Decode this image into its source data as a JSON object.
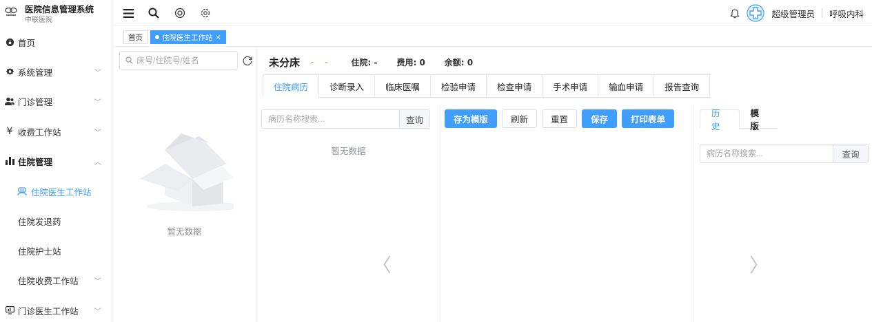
{
  "brand": {
    "title": "医院信息管理系统",
    "subtitle": "中联医院"
  },
  "sidebar": {
    "items": [
      {
        "label": "首页",
        "icon": "dashboard-icon"
      },
      {
        "label": "系统管理",
        "icon": "gear-icon"
      },
      {
        "label": "门诊管理",
        "icon": "users-icon"
      },
      {
        "label": "收费工作站",
        "icon": "yen-icon"
      },
      {
        "label": "住院管理",
        "icon": "bar-chart-icon"
      },
      {
        "label": "住院医生工作站",
        "icon": "doctor-icon"
      },
      {
        "label": "住院发退药"
      },
      {
        "label": "住院护士站"
      },
      {
        "label": "住院收费工作站"
      },
      {
        "label": "门诊医生工作站",
        "icon": "monitor-icon"
      }
    ]
  },
  "header": {
    "user": "超级管理员",
    "dept": "呼吸内科"
  },
  "tags": {
    "home": "首页",
    "current": "住院医生工作站"
  },
  "patient_list": {
    "search_placeholder": "床号/住院号/姓名",
    "empty_text": "暂无数据"
  },
  "patient_info": {
    "bed": "未分床",
    "dash": "- -",
    "inpatient": "住院: -",
    "fee": "费用: 0",
    "balance": "余额: 0"
  },
  "tabs": [
    "住院病历",
    "诊断录入",
    "临床医嘱",
    "检验申请",
    "检查申请",
    "手术申请",
    "输血申请",
    "报告查询"
  ],
  "record_panel": {
    "search_placeholder": "病历名称搜索...",
    "query": "查询",
    "empty_text": "暂无数据"
  },
  "toolbar": {
    "save_template": "存为模版",
    "refresh": "刷新",
    "reset": "重置",
    "save": "保存",
    "print": "打印表单"
  },
  "history_panel": {
    "tab_history": "历史",
    "tab_template": "模版",
    "search_placeholder": "病历名称搜索...",
    "query": "查询"
  },
  "colors": {
    "primary": "#409eff",
    "warning": "#e6a23c"
  }
}
